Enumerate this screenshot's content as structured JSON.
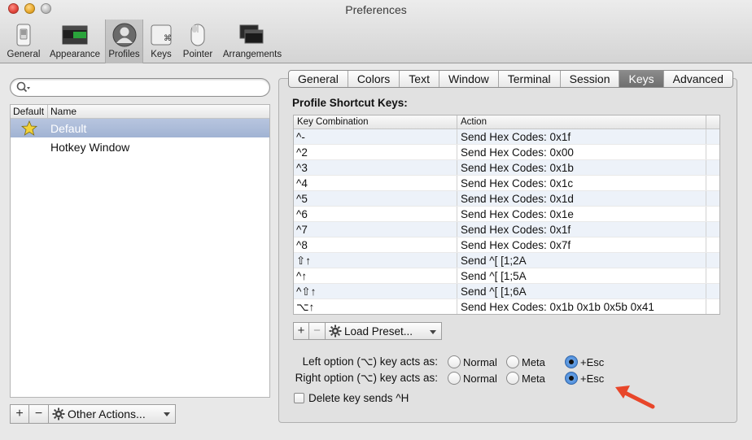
{
  "window": {
    "title": "Preferences"
  },
  "toolbar": {
    "items": [
      {
        "label": "General",
        "icon": "switch-icon"
      },
      {
        "label": "Appearance",
        "icon": "window-icon"
      },
      {
        "label": "Profiles",
        "icon": "person-icon",
        "selected": true
      },
      {
        "label": "Keys",
        "icon": "command-key-icon"
      },
      {
        "label": "Pointer",
        "icon": "mouse-icon"
      },
      {
        "label": "Arrangements",
        "icon": "windows-stack-icon"
      }
    ]
  },
  "profiles": {
    "columns": {
      "default": "Default",
      "name": "Name"
    },
    "rows": [
      {
        "name": "Default",
        "is_default": true,
        "selected": true
      },
      {
        "name": "Hotkey Window",
        "is_default": false
      }
    ],
    "add_button": "+",
    "remove_button": "−",
    "other_actions": "Other Actions..."
  },
  "tabs": [
    "General",
    "Colors",
    "Text",
    "Window",
    "Terminal",
    "Session",
    "Keys",
    "Advanced"
  ],
  "active_tab": "Keys",
  "keys_panel": {
    "title": "Profile Shortcut Keys:",
    "columns": {
      "key": "Key Combination",
      "action": "Action"
    },
    "rows": [
      {
        "key": "^-",
        "action": "Send Hex Codes: 0x1f"
      },
      {
        "key": "^2",
        "action": "Send Hex Codes: 0x00"
      },
      {
        "key": "^3",
        "action": "Send Hex Codes: 0x1b"
      },
      {
        "key": "^4",
        "action": "Send Hex Codes: 0x1c"
      },
      {
        "key": "^5",
        "action": "Send Hex Codes: 0x1d"
      },
      {
        "key": "^6",
        "action": "Send Hex Codes: 0x1e"
      },
      {
        "key": "^7",
        "action": "Send Hex Codes: 0x1f"
      },
      {
        "key": "^8",
        "action": "Send Hex Codes: 0x7f"
      },
      {
        "key": "⇧↑",
        "action": "Send ^[ [1;2A"
      },
      {
        "key": "^↑",
        "action": "Send ^[ [1;5A"
      },
      {
        "key": "^⇧↑",
        "action": "Send ^[ [1;6A"
      },
      {
        "key": "⌥↑",
        "action": "Send Hex Codes: 0x1b 0x1b 0x5b 0x41"
      }
    ],
    "add_button": "+",
    "remove_button": "−",
    "load_preset": "Load Preset..."
  },
  "options": {
    "left_option_label": "Left option (⌥) key acts as:",
    "right_option_label": "Right option (⌥) key acts as:",
    "choices": [
      "Normal",
      "Meta",
      "+Esc"
    ],
    "left_selected": "+Esc",
    "right_selected": "+Esc",
    "delete_key_label": "Delete key sends ^H",
    "delete_key_checked": false
  },
  "colors": {
    "selection": "#a9b9d8",
    "active_tab": "#7c7c7c",
    "arrow": "#e8462a",
    "radio_on": "#3d7fd4"
  }
}
